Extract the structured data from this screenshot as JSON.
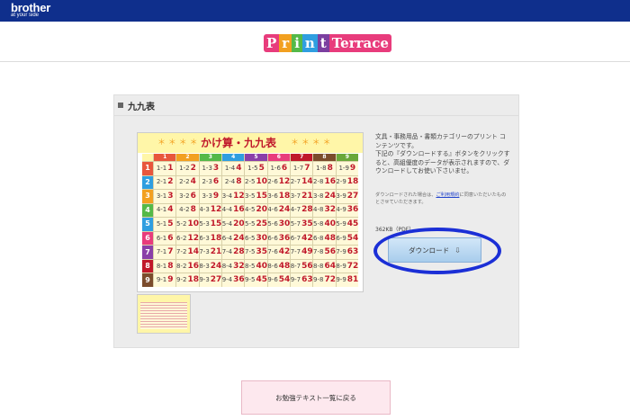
{
  "header": {
    "brand": "brother",
    "tagline": "at your side"
  },
  "logo": {
    "parts": [
      "P",
      "r",
      "i",
      "n",
      "t",
      "Terrace"
    ]
  },
  "section": {
    "title": "九九表",
    "chart_title": "かけ算・九九表",
    "star_text": "＊ ＊ ＊ ＊",
    "column_headers": [
      "1",
      "2",
      "3",
      "4",
      "5",
      "6",
      "7",
      "8",
      "9"
    ],
    "row_headers": [
      "1",
      "2",
      "3",
      "4",
      "5",
      "6",
      "7",
      "8",
      "9"
    ]
  },
  "description": {
    "line1": "文具・事務用品・書類カテゴリーのプリント コンテンツです。",
    "line2": "下記の『ダウンロードする』ボタンをクリックすると、高組優度のデータが表示されますので、ダウンロードしてお使い下さいませ。",
    "note_prefix": "ダウンロードされた場合は、",
    "note_link": "ご利用規約",
    "note_suffix": "に同意いただいたものとさせていただきます。",
    "file_size": "362KB（PDF）"
  },
  "buttons": {
    "download": "ダウンロード",
    "back": "お勉強テキスト一覧に戻る"
  },
  "colors": {
    "topbar": "#0f2f8c",
    "highlight": "#1b2fd6",
    "header_row": [
      "#e8563c",
      "#f2a020",
      "#54b948",
      "#2f9ee0",
      "#8a3fa8",
      "#e83c7c",
      "#c0182a",
      "#7b4c2c",
      "#6aa83a"
    ],
    "row_colors": [
      "#e8563c",
      "#2f9ee0",
      "#f2a020",
      "#54b948",
      "#2f9ee0",
      "#e83c7c",
      "#8a3fa8",
      "#c0182a",
      "#7b4c2c"
    ]
  }
}
